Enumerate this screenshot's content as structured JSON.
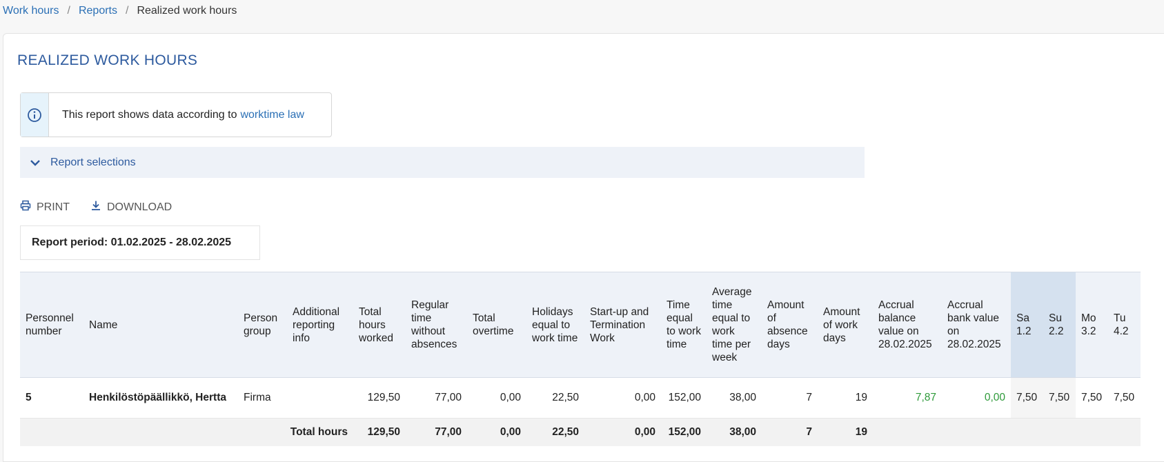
{
  "breadcrumb": {
    "item1": "Work hours",
    "sep": "/",
    "item2": "Reports",
    "current": "Realized work hours"
  },
  "page": {
    "title": "REALIZED WORK HOURS"
  },
  "info": {
    "text": "This report shows data according to",
    "link": "worktime law",
    "icon": "info-icon"
  },
  "selections": {
    "label": "Report selections",
    "icon": "chevron-down-icon"
  },
  "actions": {
    "print": "PRINT",
    "download": "DOWNLOAD"
  },
  "period": {
    "text": "Report period: 01.02.2025 - 28.02.2025"
  },
  "table": {
    "headers": [
      "Personnel number",
      "Name",
      "Person group",
      "Additional reporting info",
      "Total hours worked",
      "Regular time without absences",
      "Total overtime",
      "Holidays equal to work time",
      "Start-up and Termination Work",
      "Time equal to work time",
      "Average time equal to work time per week",
      "Amount of absence days",
      "Amount of work days",
      "Accrual balance value on 28.02.2025",
      "Accrual bank value on 28.02.2025",
      "Sa 1.2",
      "Su 2.2",
      "Mo 3.2",
      "Tu 4.2"
    ],
    "row": {
      "number": "5",
      "name": "Henkilöstöpäällikkö, Hertta",
      "group": "Firma",
      "info": "",
      "total": "129,50",
      "regular": "77,00",
      "overtime": "0,00",
      "holidays": "22,50",
      "startup": "0,00",
      "equal": "152,00",
      "avg": "38,00",
      "absence": "7",
      "workdays": "19",
      "accrual_balance": "7,87",
      "accrual_bank": "0,00",
      "d1": "7,50",
      "d2": "7,50",
      "d3": "7,50",
      "d4": "7,50"
    },
    "totals": {
      "label": "Total hours",
      "total": "129,50",
      "regular": "77,00",
      "overtime": "0,00",
      "holidays": "22,50",
      "startup": "0,00",
      "equal": "152,00",
      "avg": "38,00",
      "absence": "7",
      "workdays": "19"
    }
  },
  "colors": {
    "accent": "#2d5a9e",
    "link": "#2a6fb5",
    "positive": "#2e9a3a",
    "header_bg": "#eef2f8",
    "weekend_bg": "#d5e1ef"
  }
}
